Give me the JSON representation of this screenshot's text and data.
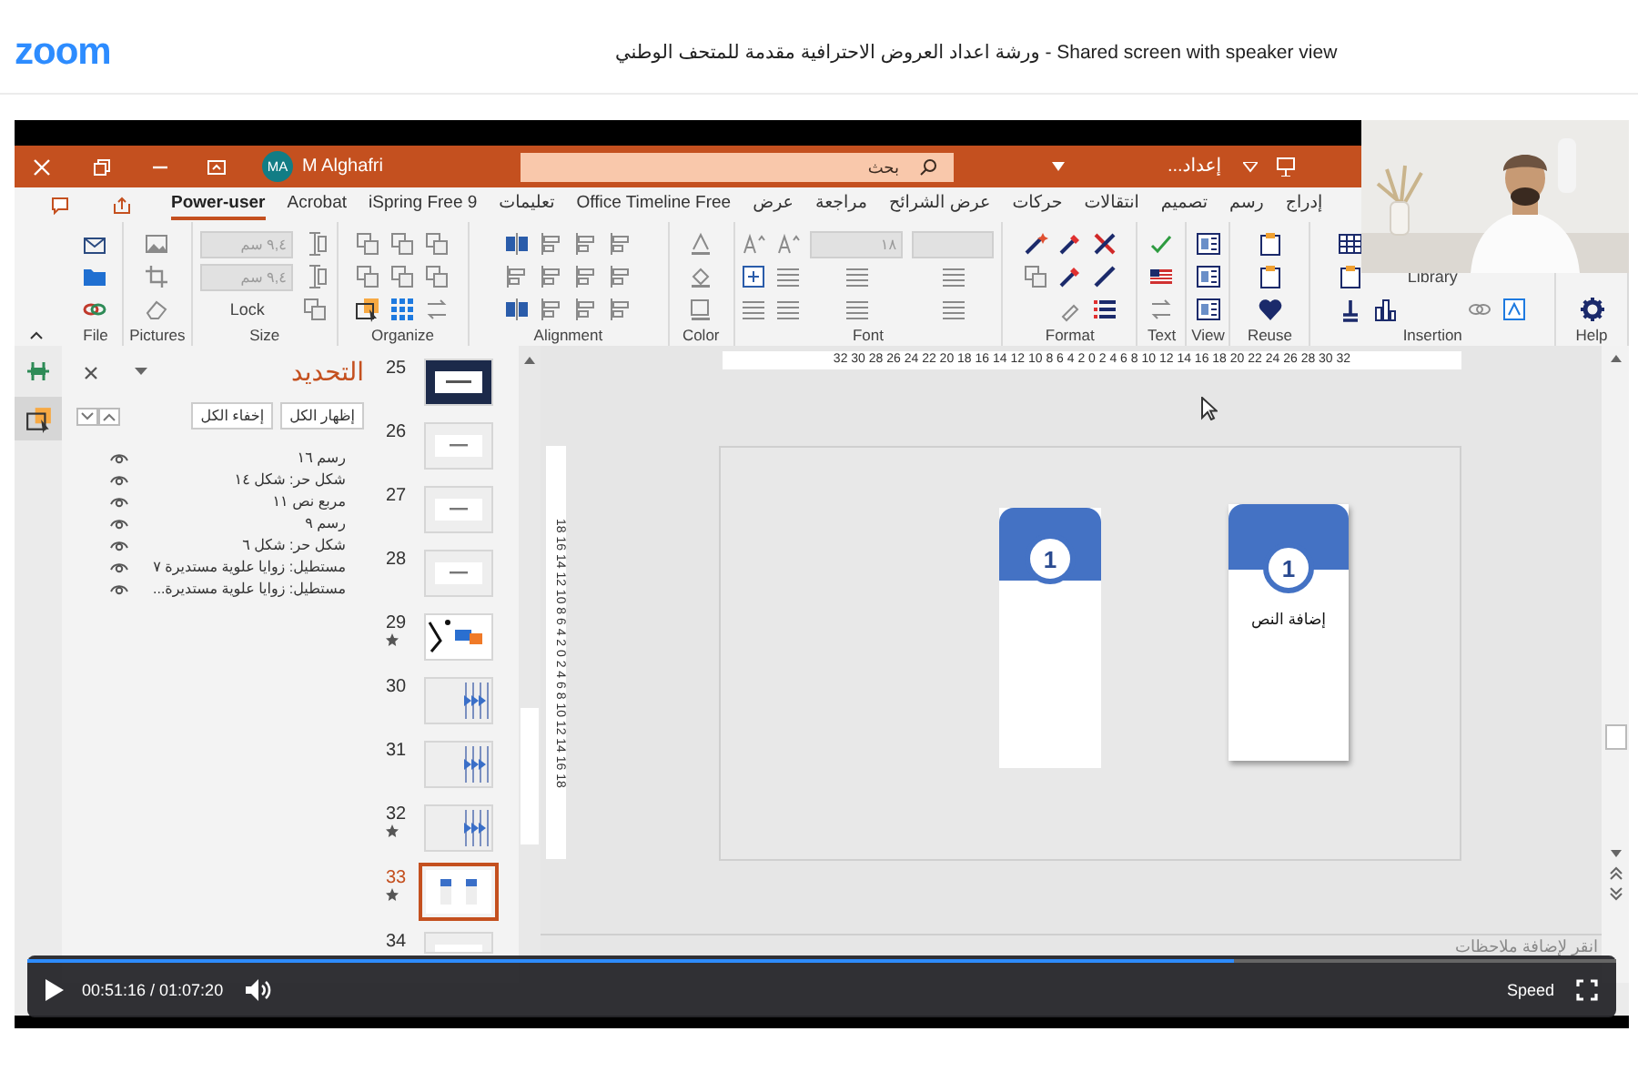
{
  "header": {
    "logo": "zoom",
    "title": "ورشة اعداد العروض الاحترافية مقدمة للمتحف الوطني - Shared screen with speaker view"
  },
  "powerpoint": {
    "title_bar": {
      "initials": "MA",
      "user": "M Alghafri",
      "search_placeholder": "بحث",
      "document": "إعداد..."
    },
    "tabs": [
      {
        "label": "إدراج",
        "selected": false
      },
      {
        "label": "رسم",
        "selected": false
      },
      {
        "label": "تصميم",
        "selected": false
      },
      {
        "label": "انتقالات",
        "selected": false
      },
      {
        "label": "حركات",
        "selected": false
      },
      {
        "label": "عرض الشرائح",
        "selected": false
      },
      {
        "label": "مراجعة",
        "selected": false
      },
      {
        "label": "عرض",
        "selected": false
      },
      {
        "label": "Office Timeline Free",
        "selected": false
      },
      {
        "label": "تعليمات",
        "selected": false
      },
      {
        "label": "iSpring Free 9",
        "selected": false
      },
      {
        "label": "Acrobat",
        "selected": false
      },
      {
        "label": "Power-user",
        "selected": true
      }
    ],
    "ribbon": [
      {
        "label": "Help"
      },
      {
        "label": "Insertion",
        "button": "Library"
      },
      {
        "label": "Reuse"
      },
      {
        "label": "View"
      },
      {
        "label": "Text"
      },
      {
        "label": "Format"
      },
      {
        "label": "Font",
        "fields": [
          "١٨"
        ]
      },
      {
        "label": "Color"
      },
      {
        "label": "Alignment"
      },
      {
        "label": "Organize"
      },
      {
        "label": "Size",
        "fields": [
          "٩,٤ سم",
          "٩,٤ سم"
        ],
        "button": "Lock"
      },
      {
        "label": "Pictures"
      },
      {
        "label": "File"
      }
    ],
    "selection_pane": {
      "title": "التحديد",
      "buttons": [
        "إظهار الكل",
        "إخفاء الكل"
      ],
      "items": [
        "رسم ١٦",
        "شكل حر: شكل ١٤",
        "مربع نص ١١",
        "رسم ٩",
        "شكل حر: شكل ٦",
        "مستطيل: زوايا علوية مستديرة ٧",
        "مستطيل: زوايا علوية مستديرة..."
      ]
    },
    "slides": [
      {
        "number": "25",
        "kind": "dark",
        "starred": false,
        "selected": false
      },
      {
        "number": "26",
        "kind": "plain",
        "starred": false,
        "selected": false
      },
      {
        "number": "27",
        "kind": "plain",
        "starred": false,
        "selected": false
      },
      {
        "number": "28",
        "kind": "plain",
        "starred": false,
        "selected": false
      },
      {
        "number": "29",
        "kind": "diagram",
        "starred": true,
        "selected": false
      },
      {
        "number": "30",
        "kind": "arrows",
        "starred": false,
        "selected": false
      },
      {
        "number": "31",
        "kind": "arrows",
        "starred": false,
        "selected": false
      },
      {
        "number": "32",
        "kind": "arrows",
        "starred": true,
        "selected": false
      },
      {
        "number": "33",
        "kind": "cards",
        "starred": true,
        "selected": true
      },
      {
        "number": "34",
        "kind": "plain",
        "starred": false,
        "selected": false
      }
    ],
    "rulers": {
      "horizontal": "32 30 28 26 24 22 20 18 16 14 12 10 8 6 4 2 0 2 4 6 8 10 12 14 16 18 20 22 24 26 28 30 32",
      "vertical": "18 16 14 12 10 8 6 4 2 0 2 4 6 8 10 12 14 16 18"
    },
    "slide_cards": [
      {
        "number": "1"
      },
      {
        "number": "1",
        "text": "إضافة النص"
      }
    ],
    "notes_placeholder": "انقر لإضافة ملاحظات"
  },
  "player": {
    "time": "00:51:16 / 01:07:20",
    "level": 0.76,
    "speed": "Speed"
  }
}
